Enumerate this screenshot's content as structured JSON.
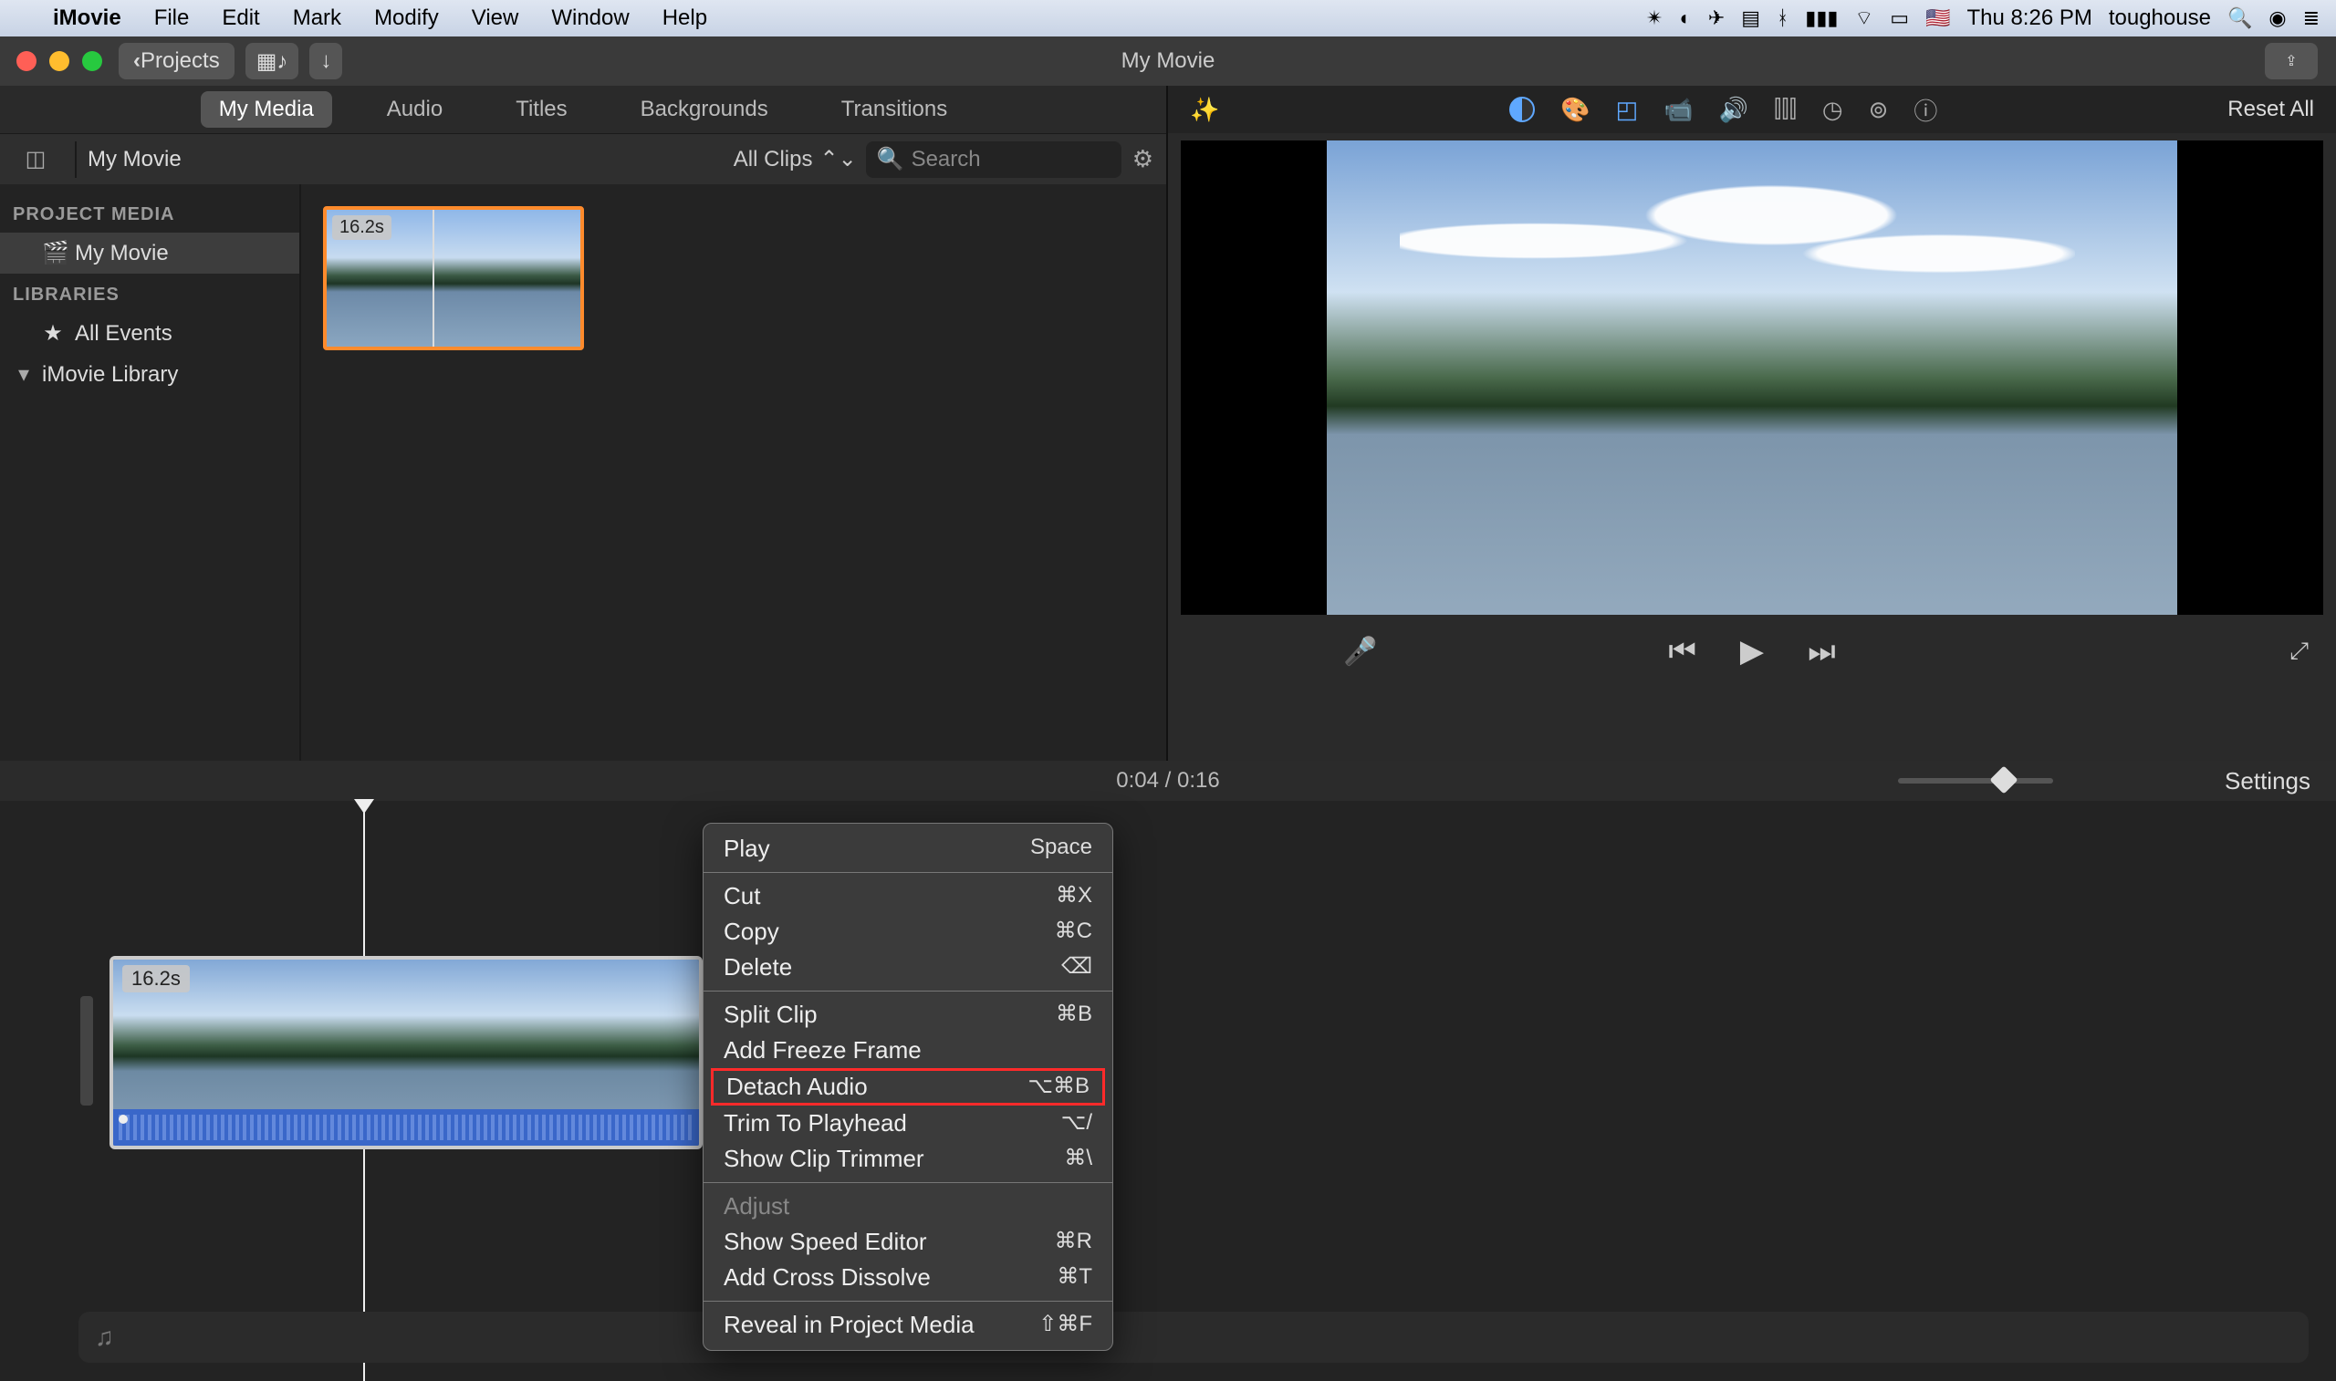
{
  "menubar": {
    "app": "iMovie",
    "items": [
      "File",
      "Edit",
      "Mark",
      "Modify",
      "View",
      "Window",
      "Help"
    ],
    "clock": "Thu 8:26 PM",
    "user": "toughouse"
  },
  "titlebar": {
    "projects": "Projects",
    "title": "My Movie"
  },
  "library_tabs": [
    "My Media",
    "Audio",
    "Titles",
    "Backgrounds",
    "Transitions"
  ],
  "library_tabs_active": 0,
  "browser": {
    "crumb": "My Movie",
    "filter": "All Clips",
    "search_placeholder": "Search"
  },
  "sidebar": {
    "headers": [
      "PROJECT MEDIA",
      "LIBRARIES"
    ],
    "project_items": [
      {
        "label": "My Movie",
        "active": true
      }
    ],
    "library_items": [
      {
        "label": "All Events",
        "icon": "star"
      },
      {
        "label": "iMovie Library",
        "icon": "chev"
      }
    ]
  },
  "clip": {
    "duration": "16.2s"
  },
  "adjust": {
    "reset": "Reset All"
  },
  "time": {
    "current": "0:04",
    "total": "0:16"
  },
  "settings_label": "Settings",
  "timeline_clip": {
    "duration": "16.2s"
  },
  "ctx": {
    "items": [
      {
        "label": "Play",
        "shortcut": "Space",
        "sep_after": true
      },
      {
        "label": "Cut",
        "shortcut": "⌘X"
      },
      {
        "label": "Copy",
        "shortcut": "⌘C"
      },
      {
        "label": "Delete",
        "shortcut": "⌫",
        "sep_after": true
      },
      {
        "label": "Split Clip",
        "shortcut": "⌘B"
      },
      {
        "label": "Add Freeze Frame",
        "shortcut": ""
      },
      {
        "label": "Detach Audio",
        "shortcut": "⌥⌘B",
        "highlight": true
      },
      {
        "label": "Trim To Playhead",
        "shortcut": "⌥/"
      },
      {
        "label": "Show Clip Trimmer",
        "shortcut": "⌘\\",
        "sep_after": true
      },
      {
        "label": "Adjust",
        "shortcut": "",
        "disabled": true
      },
      {
        "label": "Show Speed Editor",
        "shortcut": "⌘R"
      },
      {
        "label": "Add Cross Dissolve",
        "shortcut": "⌘T",
        "sep_after": true
      },
      {
        "label": "Reveal in Project Media",
        "shortcut": "⇧⌘F"
      }
    ]
  }
}
